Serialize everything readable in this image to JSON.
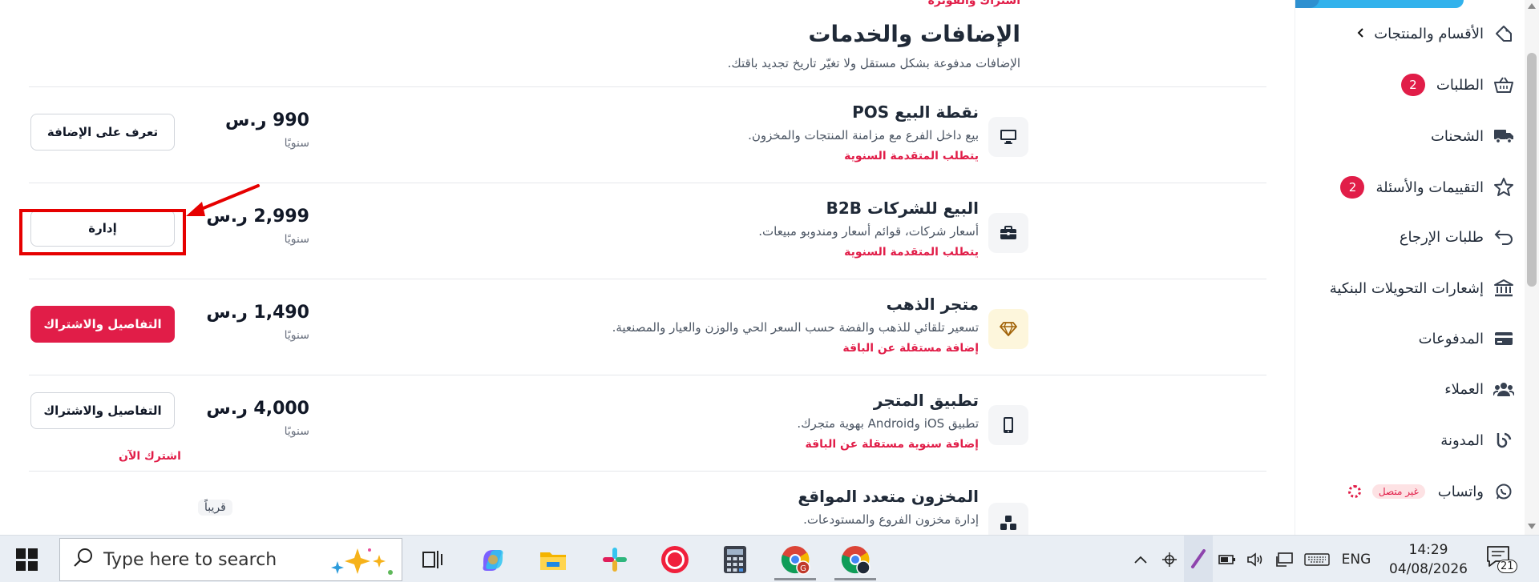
{
  "main": {
    "cutoff_header": "اشتراك والفوترة",
    "title": "الإضافات والخدمات",
    "subtitle": "الإضافات مدفوعة بشكل مستقل ولا تغيّر تاريخ تجديد باقتك.",
    "addons": [
      {
        "name": "نقطة البيع POS",
        "description": "بيع داخل الفرع مع مزامنة المنتجات والمخزون.",
        "requirement": "يتطلب المتقدمة السنوية",
        "price": "990 ر.س",
        "period": "سنويًا",
        "button": "تعرف على الإضافة",
        "icon": "monitor-icon"
      },
      {
        "name": "البيع للشركات B2B",
        "description": "أسعار شركات، قوائم أسعار ومندوبو مبيعات.",
        "requirement": "يتطلب المتقدمة السنوية",
        "price": "2,999 ر.س",
        "period": "سنويًا",
        "button": "إدارة",
        "icon": "briefcase-icon"
      },
      {
        "name": "متجر الذهب",
        "description": "تسعير تلقائي للذهب والفضة حسب السعر الحي والوزن والعيار والمصنعية.",
        "requirement": "إضافة مستقلة عن الباقة",
        "price": "1,490 ر.س",
        "period": "سنويًا",
        "button": "التفاصيل والاشتراك",
        "icon": "diamond-icon"
      },
      {
        "name": "تطبيق المتجر",
        "description": "تطبيق iOS وAndroid بهوية متجرك.",
        "requirement": "إضافة سنوية مستقلة عن الباقة",
        "price": "4,000 ر.س",
        "period": "سنويًا",
        "button": "التفاصيل والاشتراك",
        "subscribe_now": "اشترك الآن",
        "icon": "smartphone-icon"
      },
      {
        "name": "المخزون متعدد المواقع",
        "description": "إدارة مخزون الفروع والمستودعات.",
        "badge": "قريباً",
        "icon": "boxes-icon"
      }
    ]
  },
  "sidebar": {
    "items": [
      {
        "label": "الأقسام والمنتجات",
        "icon": "tag-icon"
      },
      {
        "label": "الطلبات",
        "badge": "2",
        "icon": "basket-icon"
      },
      {
        "label": "الشحنات",
        "icon": "truck-icon"
      },
      {
        "label": "التقييمات والأسئلة",
        "badge": "2",
        "icon": "star-icon"
      },
      {
        "label": "طلبات الإرجاع",
        "icon": "return-icon"
      },
      {
        "label": "إشعارات التحويلات البنكية",
        "icon": "bank-icon"
      },
      {
        "label": "المدفوعات",
        "icon": "card-icon"
      },
      {
        "label": "العملاء",
        "icon": "users-icon"
      },
      {
        "label": "المدونة",
        "icon": "blog-icon"
      },
      {
        "label": "واتساب",
        "status": "غير متصل",
        "icon": "whatsapp-icon"
      }
    ]
  },
  "taskbar": {
    "search_placeholder": "Type here to search",
    "language": "ENG",
    "time": "14:29",
    "date": "04/08/2026",
    "notification_count": "21"
  },
  "colors": {
    "accent": "#e11d48",
    "highlight": "#e60000"
  }
}
